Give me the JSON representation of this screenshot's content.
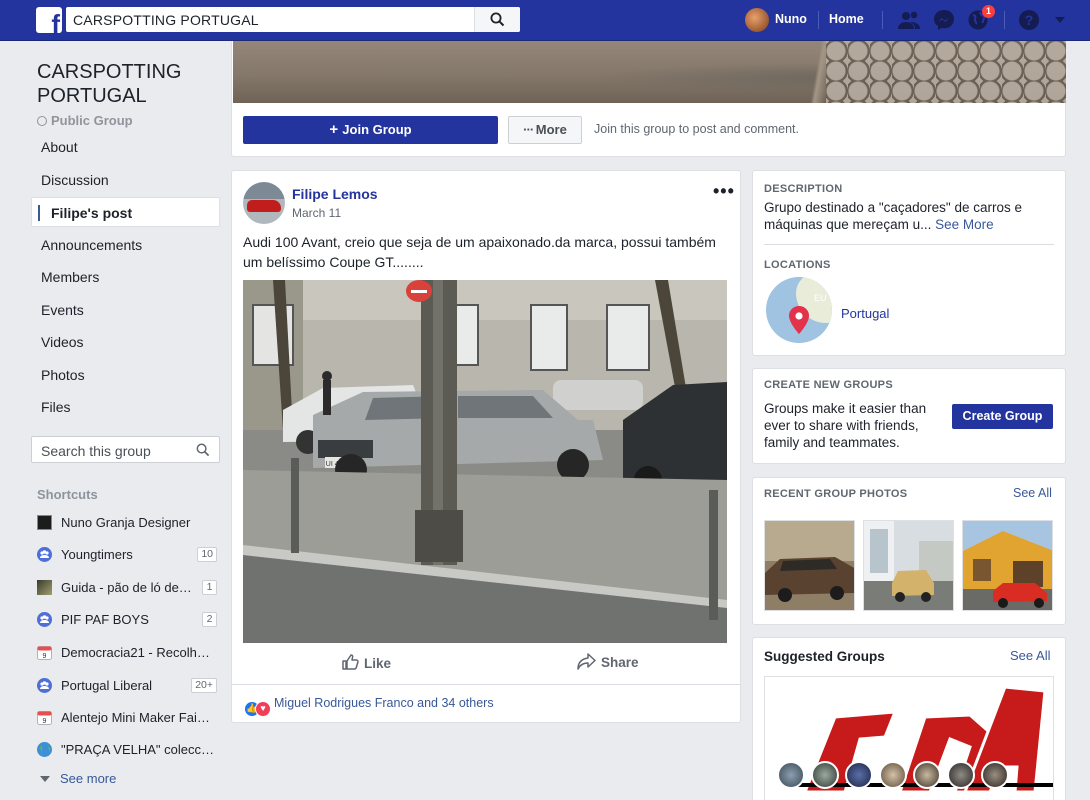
{
  "topbar": {
    "search_value": "CARSPOTTING PORTUGAL",
    "user_name": "Nuno",
    "home_label": "Home",
    "notification_count": "1"
  },
  "group": {
    "title": "CARSPOTTING PORTUGAL",
    "type": "Public Group"
  },
  "nav": {
    "items": [
      {
        "label": "About"
      },
      {
        "label": "Discussion"
      },
      {
        "label": "Filipe's post"
      },
      {
        "label": "Announcements"
      },
      {
        "label": "Members"
      },
      {
        "label": "Events"
      },
      {
        "label": "Videos"
      },
      {
        "label": "Photos"
      },
      {
        "label": "Files"
      }
    ],
    "search_placeholder": "Search this group"
  },
  "shortcuts": {
    "heading": "Shortcuts",
    "items": [
      {
        "label": "Nuno Granja Designer",
        "count": "",
        "icon": "page-icon"
      },
      {
        "label": "Youngtimers",
        "count": "10",
        "icon": "group-icon"
      },
      {
        "label": "Guida - pão de ló de…",
        "count": "1",
        "icon": "page-icon"
      },
      {
        "label": "PIF PAF BOYS",
        "count": "2",
        "icon": "group-icon"
      },
      {
        "label": "Democracia21 - Recolh…",
        "count": "",
        "icon": "calendar-icon"
      },
      {
        "label": "Portugal Liberal",
        "count": "20+",
        "icon": "group-icon"
      },
      {
        "label": "Alentejo Mini Maker Fai…",
        "count": "",
        "icon": "calendar-icon"
      },
      {
        "label": "\"PRAÇA VELHA\" colecc…",
        "count": "",
        "icon": "globe-icon"
      }
    ],
    "see_more": "See more"
  },
  "cover": {
    "join_label": "Join Group",
    "more_label": "More",
    "hint": "Join this group to post and comment."
  },
  "post": {
    "author": "Filipe Lemos",
    "date": "March 11",
    "text": "Audi 100 Avant, creio que seja de um apaixonado.da marca, possui também um belíssimo Coupe GT........",
    "like_label": "Like",
    "share_label": "Share",
    "reactions_text": "Miguel Rodrigues Franco and 34 others",
    "plate_text": "UI 42 82"
  },
  "sidebar_right": {
    "description_heading": "DESCRIPTION",
    "description_text": "Grupo destinado a \"caçadores\" de carros e máquinas que mereçam u...",
    "description_more": "See More",
    "locations_heading": "LOCATIONS",
    "location_name": "Portugal",
    "map_label": "EU",
    "create_heading": "CREATE NEW GROUPS",
    "create_text": "Groups make it easier than ever to share with friends, family and teammates.",
    "create_button": "Create Group",
    "photos_heading": "RECENT GROUP PHOTOS",
    "photos_see_all": "See All",
    "suggested_heading": "Suggested Groups",
    "suggested_see_all": "See All"
  },
  "colors": {
    "topbar": "#23349e",
    "link": "#385898",
    "background": "#e9ebee"
  }
}
